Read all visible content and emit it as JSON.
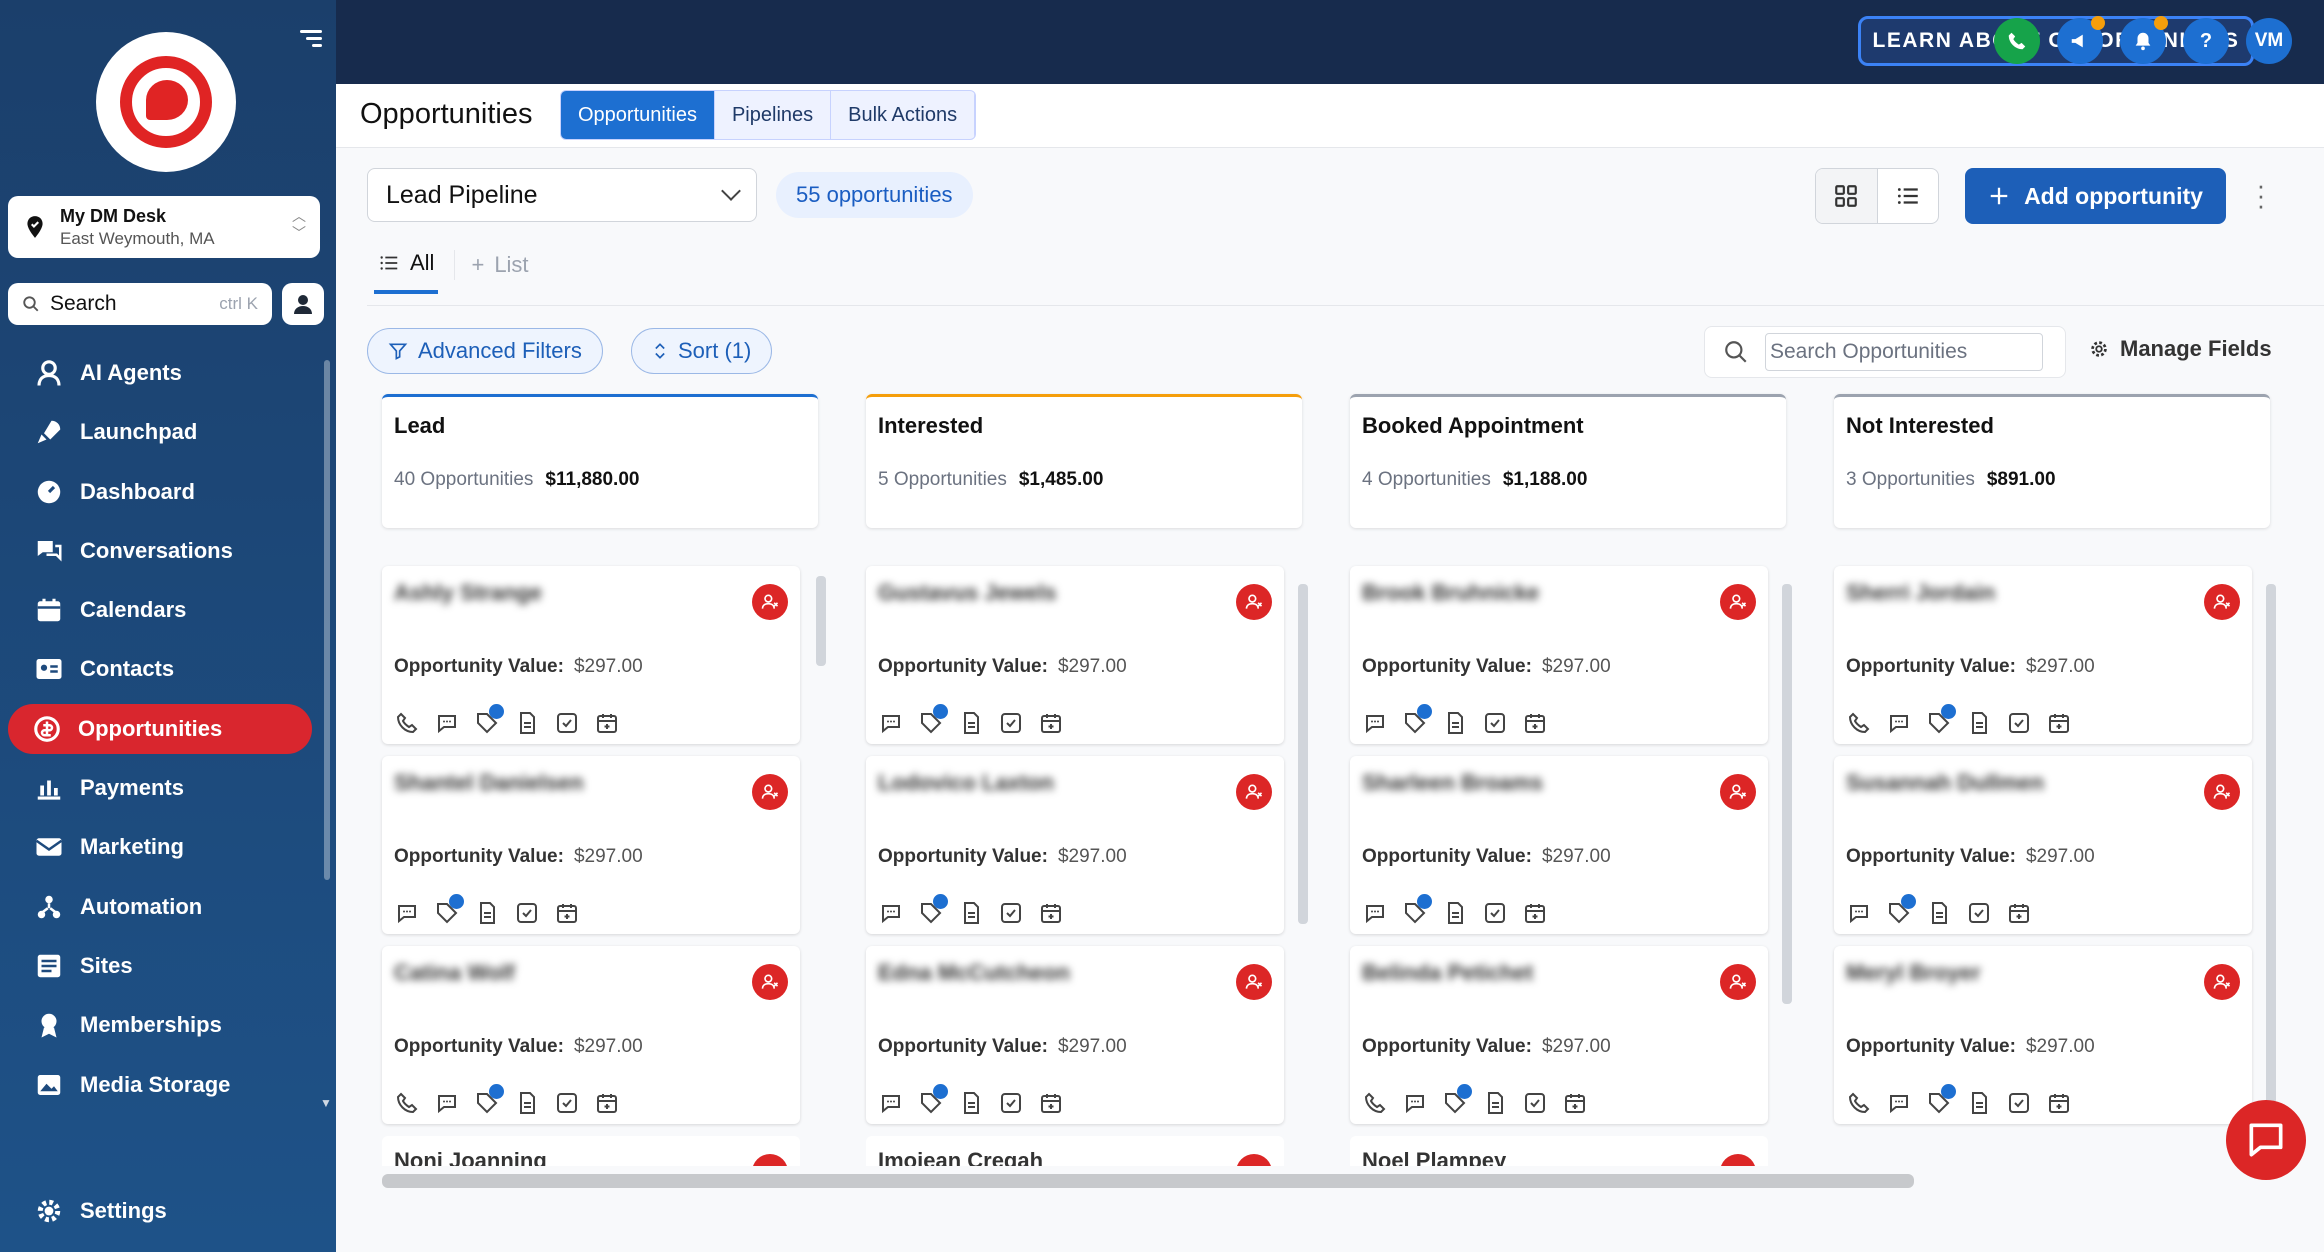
{
  "sidebar": {
    "location": {
      "name": "My DM Desk",
      "sub": "East Weymouth, MA"
    },
    "search": {
      "label": "Search",
      "hint": "ctrl K"
    },
    "items": [
      {
        "label": "AI Agents",
        "icon": "ai-agent-icon"
      },
      {
        "label": "Launchpad",
        "icon": "rocket-icon"
      },
      {
        "label": "Dashboard",
        "icon": "dashboard-icon"
      },
      {
        "label": "Conversations",
        "icon": "chat-icon"
      },
      {
        "label": "Calendars",
        "icon": "calendar-icon"
      },
      {
        "label": "Contacts",
        "icon": "contacts-icon"
      },
      {
        "label": "Opportunities",
        "icon": "opportunity-icon",
        "active": true
      },
      {
        "label": "Payments",
        "icon": "payments-icon"
      },
      {
        "label": "Marketing",
        "icon": "marketing-icon"
      },
      {
        "label": "Automation",
        "icon": "automation-icon"
      },
      {
        "label": "Sites",
        "icon": "sites-icon"
      },
      {
        "label": "Memberships",
        "icon": "memberships-icon"
      },
      {
        "label": "Media Storage",
        "icon": "media-icon"
      }
    ],
    "settings_label": "Settings"
  },
  "topbar": {
    "learn_label": "LEARN ABOUT OPPORTUNITIES",
    "avatar_initials": "VM",
    "help_label": "?",
    "colors": {
      "phone": "#16a34a",
      "icon_bg": "#1d6fd1",
      "badge": "#f59e0b"
    }
  },
  "header": {
    "title": "Opportunities",
    "tabs": [
      "Opportunities",
      "Pipelines",
      "Bulk Actions"
    ]
  },
  "toolbar": {
    "pipeline": "Lead Pipeline",
    "count": "55 opportunities",
    "add_label": "Add opportunity",
    "view_all": "All",
    "view_list": "List",
    "advanced_filters": "Advanced Filters",
    "sort": "Sort (1)",
    "search_placeholder": "Search Opportunities",
    "manage_fields": "Manage Fields"
  },
  "board": {
    "value_label": "Opportunity Value:",
    "columns": [
      {
        "stage": "Lead",
        "count": "40 Opportunities",
        "total": "$11,880.00",
        "accent": "#1d6fd1",
        "cards": [
          {
            "name": "Ashly Strange",
            "value": "$297.00"
          },
          {
            "name": "Shantel Danielsen",
            "value": "$297.00"
          },
          {
            "name": "Catina Wolf",
            "value": "$297.00"
          }
        ],
        "peek": "Noni Joanning"
      },
      {
        "stage": "Interested",
        "count": "5 Opportunities",
        "total": "$1,485.00",
        "accent": "#f59e0b",
        "cards": [
          {
            "name": "Gustavus Jewels",
            "value": "$297.00"
          },
          {
            "name": "Lodovico Laxton",
            "value": "$297.00"
          },
          {
            "name": "Edna McCutcheon",
            "value": "$297.00"
          }
        ],
        "peek": "Imojean Cregah"
      },
      {
        "stage": "Booked Appointment",
        "count": "4 Opportunities",
        "total": "$1,188.00",
        "accent": "#9ca3af",
        "cards": [
          {
            "name": "Brook Bruhnicke",
            "value": "$297.00"
          },
          {
            "name": "Sharleen Broams",
            "value": "$297.00"
          },
          {
            "name": "Belinda Petichet",
            "value": "$297.00"
          }
        ],
        "peek": "Noel Plampey"
      },
      {
        "stage": "Not Interested",
        "count": "3 Opportunities",
        "total": "$891.00",
        "accent": "#9ca3af",
        "cards": [
          {
            "name": "Sherri Jordain",
            "value": "$297.00"
          },
          {
            "name": "Susannah Dullmen",
            "value": "$297.00"
          },
          {
            "name": "Meryl Broyer",
            "value": "$297.00"
          }
        ],
        "peek": ""
      }
    ]
  }
}
